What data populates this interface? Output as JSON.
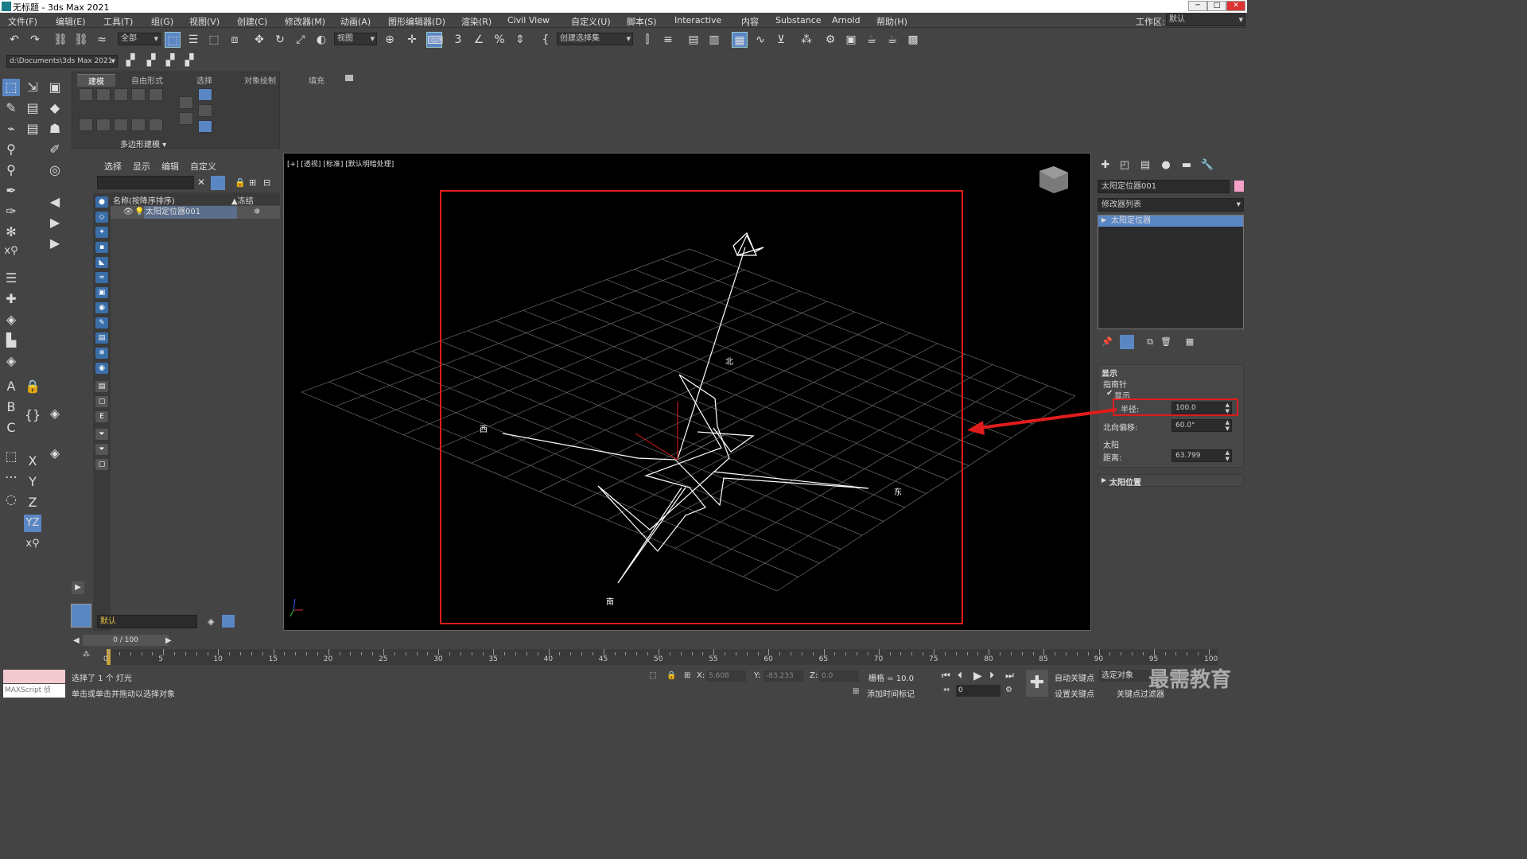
{
  "title": "无标题 - 3ds Max 2021",
  "window_buttons": [
    "─",
    "□",
    "✕"
  ],
  "menus": [
    "文件(F)",
    "编辑(E)",
    "工具(T)",
    "组(G)",
    "视图(V)",
    "创建(C)",
    "修改器(M)",
    "动画(A)",
    "图形编辑器(D)",
    "渲染(R)",
    "Civil View",
    "自定义(U)",
    "脚本(S)",
    "Interactive",
    "内容",
    "Substance",
    "Arnold",
    "帮助(H)"
  ],
  "workspace": {
    "label": "工作区:",
    "value": "默认"
  },
  "toolbar": {
    "filter": "全部",
    "ref_coord": "视图",
    "selection_set": "创建选择集"
  },
  "path": {
    "value": "d:\\Documents\\3ds Max 2021"
  },
  "ribbon": {
    "tabs": [
      "建模",
      "自由形式",
      "选择",
      "对象绘制",
      "填充"
    ],
    "footer": "多边形建模 ▾"
  },
  "scene_explorer": {
    "tabs": [
      "选择",
      "显示",
      "编辑",
      "自定义"
    ],
    "col_name": "名称(按降序排序)",
    "col_freeze": "▲冻结",
    "items": [
      {
        "name": "太阳定位器001"
      }
    ],
    "layer": "默认"
  },
  "viewport": {
    "label": "[+] [透视] [标准] [默认明暗处理]",
    "compass": {
      "north": "北",
      "south": "南",
      "east": "东",
      "west": "西"
    }
  },
  "cmd_panel": {
    "object_name": "太阳定位器001",
    "modifier_list": "修改器列表",
    "stack_item": "太阳定位器",
    "display_title": "显示",
    "compass_group": "指南针",
    "show_label": "显示",
    "radius_label": "半径:",
    "radius_value": "100.0",
    "north_offset_label": "北向偏移:",
    "north_offset_value": "60.0°",
    "sun_group": "太阳",
    "distance_label": "距离:",
    "distance_value": "63.799",
    "sun_position": "太阳位置"
  },
  "timeline": {
    "frame": "0 / 100",
    "ticks": [
      "0",
      "5",
      "10",
      "15",
      "20",
      "25",
      "30",
      "35",
      "40",
      "45",
      "50",
      "55",
      "60",
      "65",
      "70",
      "75",
      "80",
      "85",
      "90",
      "95",
      "100"
    ]
  },
  "status": {
    "maxscript": "MAXScript 侦",
    "selected": "选择了 1 个 灯光",
    "hint": "单击或单击并拖动以选择对象",
    "x_label": "X:",
    "x": "5.608",
    "y_label": "Y:",
    "y": "-83.233",
    "z_label": "Z:",
    "z": "0.0",
    "grid": "栅格 = 10.0",
    "add_time_tag": "添加时间标记",
    "auto_key": "自动关键点",
    "selected_object": "选定对象",
    "set_key": "设置关键点",
    "key_filter": "关键点过滤器",
    "frame_field": "0"
  },
  "watermark": "最需教育",
  "colors": {
    "highlight": "#e01c1c",
    "accent": "#5b86c4"
  }
}
